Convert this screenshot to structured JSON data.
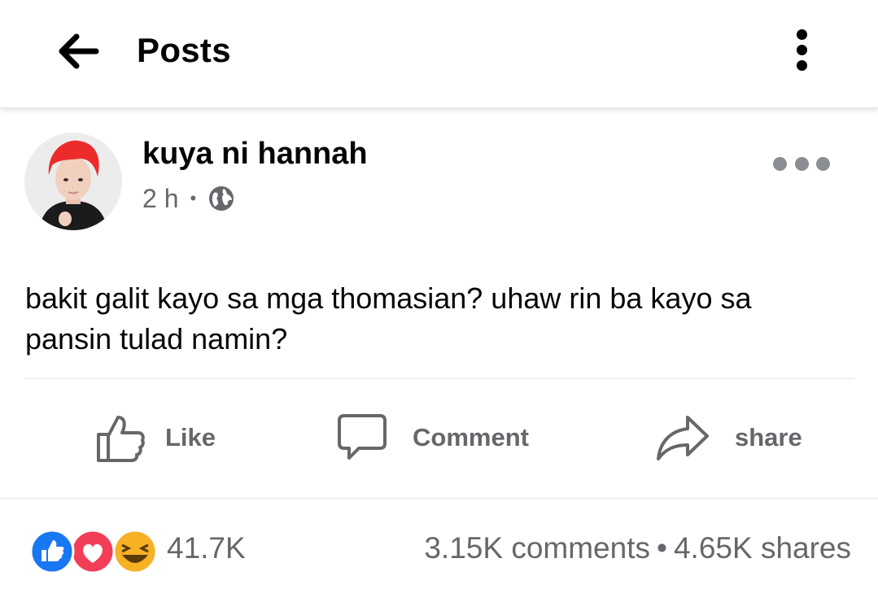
{
  "header": {
    "title": "Posts"
  },
  "post": {
    "author": "kuya ni hannah",
    "time": "2 h",
    "separator": "•",
    "text": "bakit galit kayo sa mga thomasian? uhaw rin ba kayo sa pansin tulad namin?"
  },
  "actions": {
    "like": "Like",
    "comment": "Comment",
    "share": "share"
  },
  "footer": {
    "reaction_count": "41.7K",
    "comments": "3.15K comments",
    "separator": "•",
    "shares": "4.65K shares"
  },
  "colors": {
    "text_primary": "#050505",
    "text_secondary": "#65676b",
    "like_blue": "#1877f2",
    "love_red": "#f33e58",
    "haha_yellow": "#f7b125"
  },
  "icons": [
    "back-arrow-icon",
    "kebab-menu-icon",
    "globe-icon",
    "more-dots-icon",
    "like-icon",
    "comment-icon",
    "share-icon",
    "like-reaction-icon",
    "love-reaction-icon",
    "haha-reaction-icon"
  ]
}
